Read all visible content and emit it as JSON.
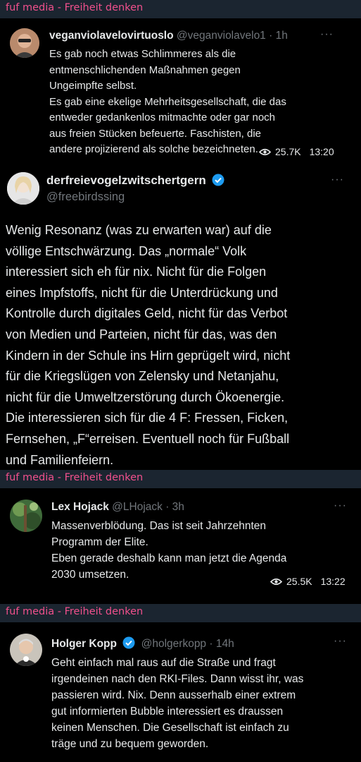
{
  "channel": {
    "name": "fuf media - Freiheit denken"
  },
  "posts": [
    {
      "name": "veganviolavelovirtuoslo",
      "handle": "@veganviolavelo1 · 1h",
      "text": "Es gab noch etwas Schlimmeres als die\nentmenschlichenden Maßnahmen gegen\nUngeimpfte selbst.\nEs gab eine ekelige Mehrheitsgesellschaft, die das\nentweder gedankenlos mitmachte oder gar noch\naus freien Stücken befeuerte. Faschisten, die\nandere projizierend als solche bezeichneten.",
      "views": "25.7K",
      "time": "13:20"
    },
    {
      "name": "derfreievogelzwitschertgern",
      "handle": "@freebirdssing",
      "text": "Wenig Resonanz (was zu erwarten war) auf die\nvöllige Entschwärzung. Das „normale“ Volk\ninteressiert sich eh für nix. Nicht für die Folgen\neines Impfstoffs, nicht für die Unterdrückung und\nKontrolle durch digitales Geld, nicht für das Verbot\nvon Medien und Parteien, nicht für das, was den\nKindern in der Schule ins Hirn geprügelt wird, nicht\nfür die Kriegslügen von Zelensky und Netanjahu,\nnicht für die Umweltzerstörung durch Ökoenergie.\nDie interessieren sich für die 4 F: Fressen, Ficken,\nFernsehen, „F“erreisen. Eventuell noch für Fußball\nund Familienfeiern."
    },
    {
      "name": "Lex Hojack",
      "handle": "@LHojack · 3h",
      "text": "Massenverblödung. Das ist seit Jahrzehnten\nProgramm der Elite.\nEben gerade deshalb kann man jetzt die Agenda\n2030 umsetzen.",
      "views": "25.5K",
      "time": "13:22"
    },
    {
      "name": "Holger Kopp",
      "handle": "@holgerkopp · 14h",
      "text": "Geht einfach mal raus auf die Straße und fragt\nirgendeinen nach den RKI-Files. Dann wisst ihr, was\npassieren wird. Nix. Denn ausserhalb einer extrem\ngut informierten Bubble interessiert es draussen\nkeinen Menschen. Die Gesellschaft ist einfach zu\nträge und zu bequem geworden."
    }
  ],
  "more_label": "···",
  "colors": {
    "channel": "#f0508c",
    "header_bg": "#1b2530",
    "muted": "#71767b",
    "verified": "#1d9bf0"
  }
}
